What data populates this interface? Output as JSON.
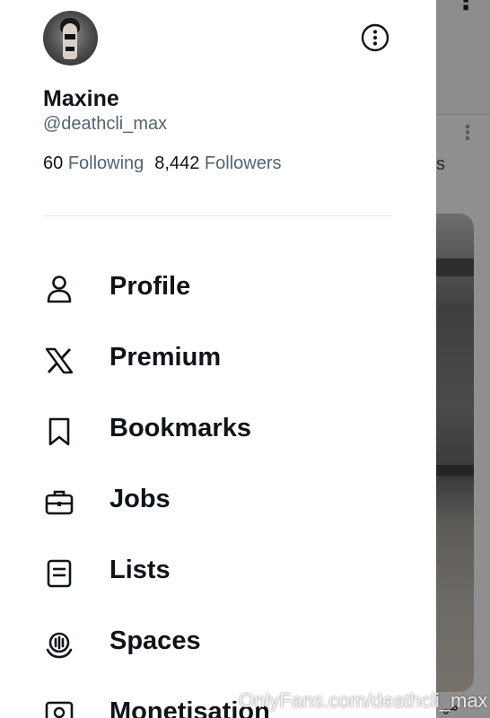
{
  "profile": {
    "display_name": "Maxine",
    "handle": "@deathcli_max",
    "following_count": "60",
    "following_label": "Following",
    "followers_count": "8,442",
    "followers_label": "Followers"
  },
  "menu": [
    {
      "label": "Profile",
      "icon": "person-icon"
    },
    {
      "label": "Premium",
      "icon": "x-logo-icon"
    },
    {
      "label": "Bookmarks",
      "icon": "bookmark-icon"
    },
    {
      "label": "Jobs",
      "icon": "briefcase-icon"
    },
    {
      "label": "Lists",
      "icon": "list-icon"
    },
    {
      "label": "Spaces",
      "icon": "spaces-icon"
    },
    {
      "label": "Monetisation",
      "icon": "monetisation-icon"
    }
  ],
  "background_feed": {
    "partial_text": "s"
  },
  "watermark": "OnlyFans.com/deathcli_max",
  "colors": {
    "primary_text": "#0f1419",
    "secondary_text": "#536471",
    "overlay": "#8f8f8f"
  }
}
